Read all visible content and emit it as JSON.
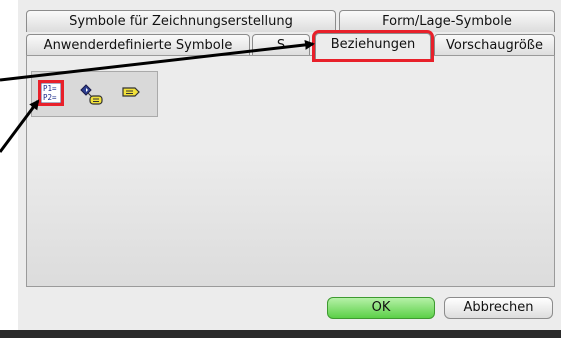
{
  "tabs_row1": [
    {
      "label": "Symbole für Zeichnungserstellung"
    },
    {
      "label": "Form/Lage-Symbole"
    }
  ],
  "tabs_row2": [
    {
      "label": "Anwenderdefinierte Symbole"
    },
    {
      "label": "S"
    },
    {
      "label": "Beziehungen",
      "active": true
    },
    {
      "label": "Vorschaugröße"
    }
  ],
  "toolbar": {
    "icons": [
      {
        "name": "relations-p1-p2-icon",
        "text_line1": "P1=",
        "text_line2": "P2="
      },
      {
        "name": "datum-relation-icon"
      },
      {
        "name": "note-relation-icon"
      }
    ]
  },
  "buttons": {
    "ok_label": "OK",
    "cancel_label": "Abbrechen"
  },
  "colors": {
    "highlight": "#e8202a",
    "ok_green": "#5cd048"
  }
}
